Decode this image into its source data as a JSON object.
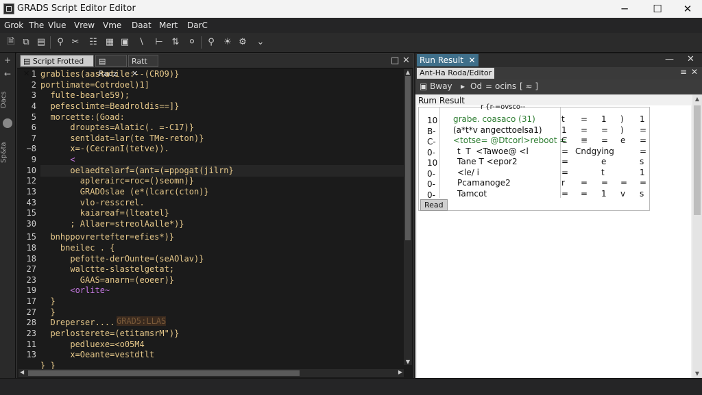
{
  "window": {
    "title": "GRADS Script Editor Editor",
    "minimize": "─",
    "maximize": "☐",
    "close": "✕"
  },
  "menu": [
    "Grok",
    "The",
    "Vlue",
    "Vrew",
    "Vme",
    "Daat",
    "Mert",
    "DarC"
  ],
  "toolbar_icons": [
    "new-file-icon",
    "copy-icon",
    "save-icon",
    "search-icon",
    "cut-icon",
    "paste-icon",
    "grid-icon",
    "crop-icon",
    "tool-icon",
    "pin-icon",
    "location-icon",
    "magnifier-icon",
    "zoom-icon",
    "dropdown-icon"
  ],
  "left_strip": {
    "add": "+",
    "arrow": "←",
    "text_top": "Dacs",
    "text_bottom": "Sp&ta"
  },
  "editor": {
    "tabs": [
      "Script Frotted",
      "Radz",
      "Ratt"
    ],
    "tab_close": "✕",
    "line_numbers": [
      "1",
      "2",
      "3",
      "4",
      "5",
      "6",
      "7",
      "−8",
      "9",
      "10",
      "12",
      "13",
      "43",
      "15",
      "30",
      "15",
      "18",
      "18",
      "27",
      "23",
      "19",
      "17",
      "27",
      "28",
      "23",
      "11",
      "13"
    ],
    "code_lines": [
      {
        "text": "grablies(aastatile:--(CRO9)}",
        "color": "#e6c88a"
      },
      {
        "text": "portlimate=Cotrdoel)1]",
        "color": "#e6c88a"
      },
      {
        "text": "  fulte-bearle59);",
        "color": "#e6c88a"
      },
      {
        "text": "  pefesclimte=Beadroldis==]}",
        "color": "#e6c88a"
      },
      {
        "text": "  morcette:(Goad:",
        "color": "#e6c88a"
      },
      {
        "text": "      drouptes=Alatic(. =-C17)}",
        "color": "#e6c88a"
      },
      {
        "text": "      sentldat=lar(te TMe-reton)}",
        "color": "#e6c88a"
      },
      {
        "text": "      x=-(CecranI(tetve)).",
        "color": "#e6c88a"
      },
      {
        "text": "      <",
        "color": "#c478e0"
      },
      {
        "text": "      oelaedtelarf=(ant=(=ppogat(jilrn}",
        "color": "#e6c88a"
      },
      {
        "text": "        aplerairc=roc=()seomn)}",
        "color": "#e6c88a"
      },
      {
        "text": "        GRADOslae (e*(lcarc(cton)}",
        "color": "#e6c88a"
      },
      {
        "text": "        vlo-resscrel.",
        "color": "#e6c88a"
      },
      {
        "text": "        kaiareaf=(lteatel}",
        "color": "#e6c88a"
      },
      {
        "text": "      ; Allaer=streolAalle*)}",
        "color": "#e6c88a"
      },
      {
        "text": "  bnhppovrertefter=efies*)}",
        "color": "#e6c88a"
      },
      {
        "text": "    bneilec . {",
        "color": "#e6c88a"
      },
      {
        "text": "      pefotte-derOunte=(seAOlav)}",
        "color": "#e6c88a"
      },
      {
        "text": "      walctte-slastelgetat;",
        "color": "#e6c88a"
      },
      {
        "text": "        GAAS=anarn=(eoeer)}",
        "color": "#e6c88a"
      },
      {
        "text": "      <orlite~",
        "color": "#c478e0"
      },
      {
        "text": "  }",
        "color": "#e6c88a"
      },
      {
        "text": "  }",
        "color": "#e6c88a"
      },
      {
        "text": "  Dreperser......",
        "color": "#e6c88a"
      },
      {
        "text": "  perlosterete=(etitamsrM\")}",
        "color": "#e6c88a"
      },
      {
        "text": "      pedluexe=<o05M4",
        "color": "#e6c88a"
      },
      {
        "text": "      x=Oeante=vestdtlt",
        "color": "#e6c88a"
      },
      {
        "text": "} }",
        "color": "#e6c88a"
      }
    ],
    "line_27_tail": "GRAD5:LLAS",
    "scroll_up": "▲",
    "scroll_down": "▼",
    "scroll_left": "◀",
    "scroll_right": "▶"
  },
  "results": {
    "tab": "Run Result",
    "tab_close": "✕",
    "min": "—",
    "close": "✕",
    "subtab": "Ant-Ha Roda/Editor",
    "sub_ctl": [
      "≡",
      "✕"
    ],
    "toolbar": [
      "▣ Bway",
      "▸",
      "Od",
      "=",
      "ocins",
      "[ ≈ ]"
    ],
    "panel_title": "Rum Result",
    "grid": {
      "left": [
        "10",
        "B-",
        "C-",
        "0-",
        "10",
        "0-",
        "0-",
        "0-"
      ],
      "middle": [
        "r {r-=ovsco--",
        "grabe. coasaco (31)",
        "(a*t*v angecttoelsa1)",
        "<totse= @Dtcorl>reboot =",
        "t  T  <Tawoe@ <l",
        "Tane T <epor2",
        "<le/ i",
        "Pcamanoge2",
        "Tamcot"
      ],
      "right_rows": [
        [
          "t",
          "=",
          "1",
          ")",
          "1"
        ],
        [
          "1",
          "=",
          "=",
          ")",
          "="
        ],
        [
          "C",
          "≡",
          "=",
          "e",
          "="
        ],
        [
          "=",
          "",
          "Cndgying",
          "",
          "="
        ],
        [
          "=",
          "",
          "e",
          "",
          "s"
        ],
        [
          "=",
          "",
          "t",
          "",
          "1"
        ],
        [
          "r",
          "=",
          "=",
          "=",
          "="
        ],
        [
          "=",
          "=",
          "1",
          "v",
          "s"
        ]
      ],
      "read_button": "Read"
    },
    "scroll_up": "▲",
    "scroll_down": "▼"
  }
}
